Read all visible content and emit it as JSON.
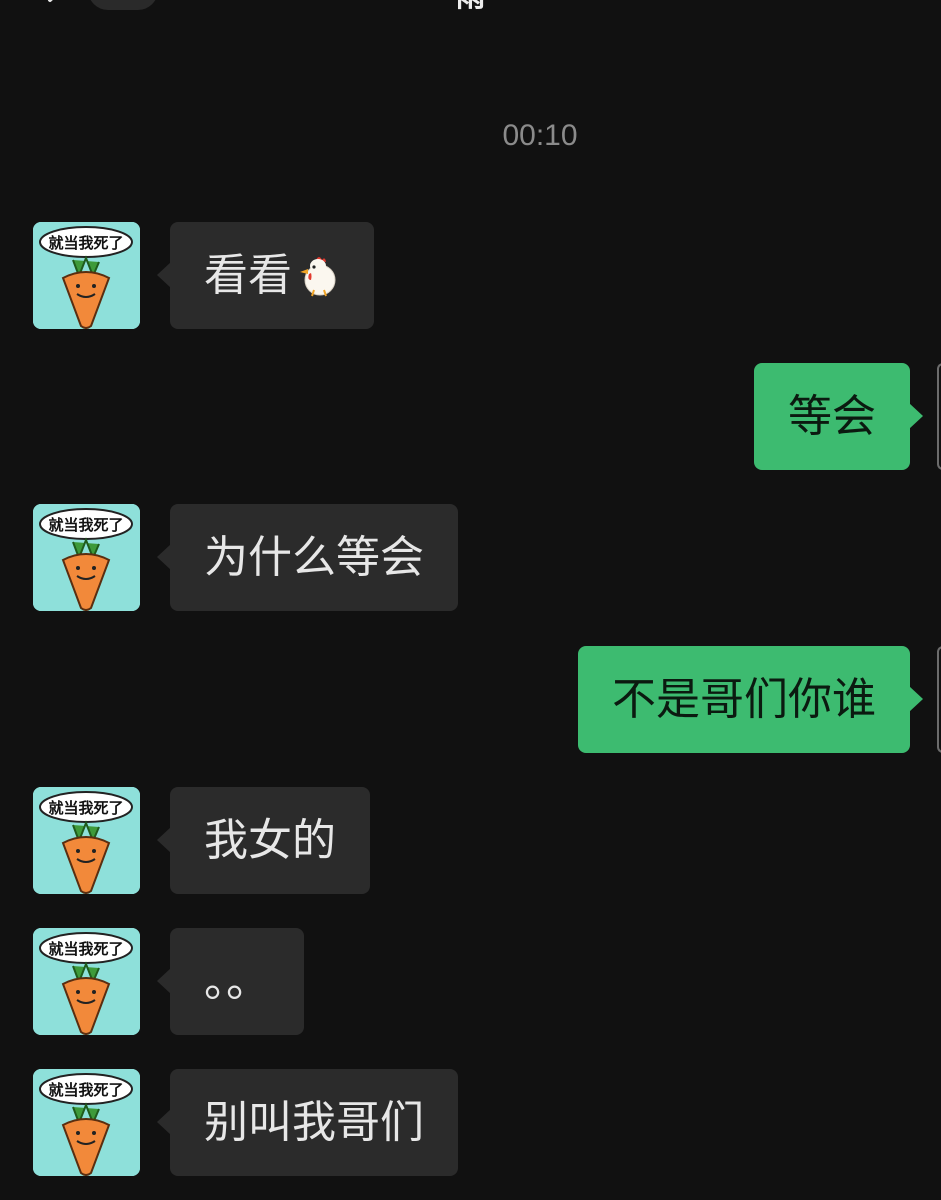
{
  "header": {
    "title": "雨"
  },
  "chat": {
    "timestamp": "00:10",
    "contact_avatar_caption": "就当我死了",
    "messages": [
      {
        "from": "contact",
        "text": "看看",
        "emoji": "chicken"
      },
      {
        "from": "me",
        "text": "等会"
      },
      {
        "from": "contact",
        "text": "为什么等会"
      },
      {
        "from": "me",
        "text": "不是哥们你谁"
      },
      {
        "from": "contact",
        "text": "我女的"
      },
      {
        "from": "contact",
        "text": "。。"
      },
      {
        "from": "contact",
        "text": "别叫我哥们"
      }
    ]
  },
  "colors": {
    "background": "#111111",
    "incoming_bubble": "#2b2b2b",
    "outgoing_bubble": "#3dbb70",
    "timestamp": "#8b8b8b"
  }
}
